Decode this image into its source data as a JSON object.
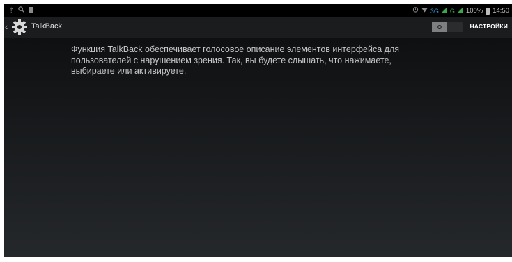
{
  "status_bar": {
    "battery": "100%",
    "time": "14:50",
    "network_3g": "3G",
    "network_g": "G",
    "left_icons": [
      "usb-icon",
      "search-icon",
      "notification-icon"
    ],
    "right_icons": [
      "alarm-icon",
      "wifi-icon",
      "signal-icon",
      "signal-icon",
      "battery-icon"
    ]
  },
  "action_bar": {
    "title": "TalkBack",
    "switch_label": "O",
    "settings_label": "НАСТРОЙКИ",
    "icon": "gear-icon"
  },
  "content": {
    "description": "Функция TalkBack обеспечивает голосовое описание элементов интерфейса для пользователей с нарушением зрения. Так, вы будете слышать, что нажимаете, выбираете или активируете."
  },
  "colors": {
    "background_top": "#0b0c0e",
    "background_bottom": "#25282b",
    "text": "#c6c6c6",
    "accent_3g": "#2ea3d6",
    "accent_signal": "#3aa84a"
  }
}
